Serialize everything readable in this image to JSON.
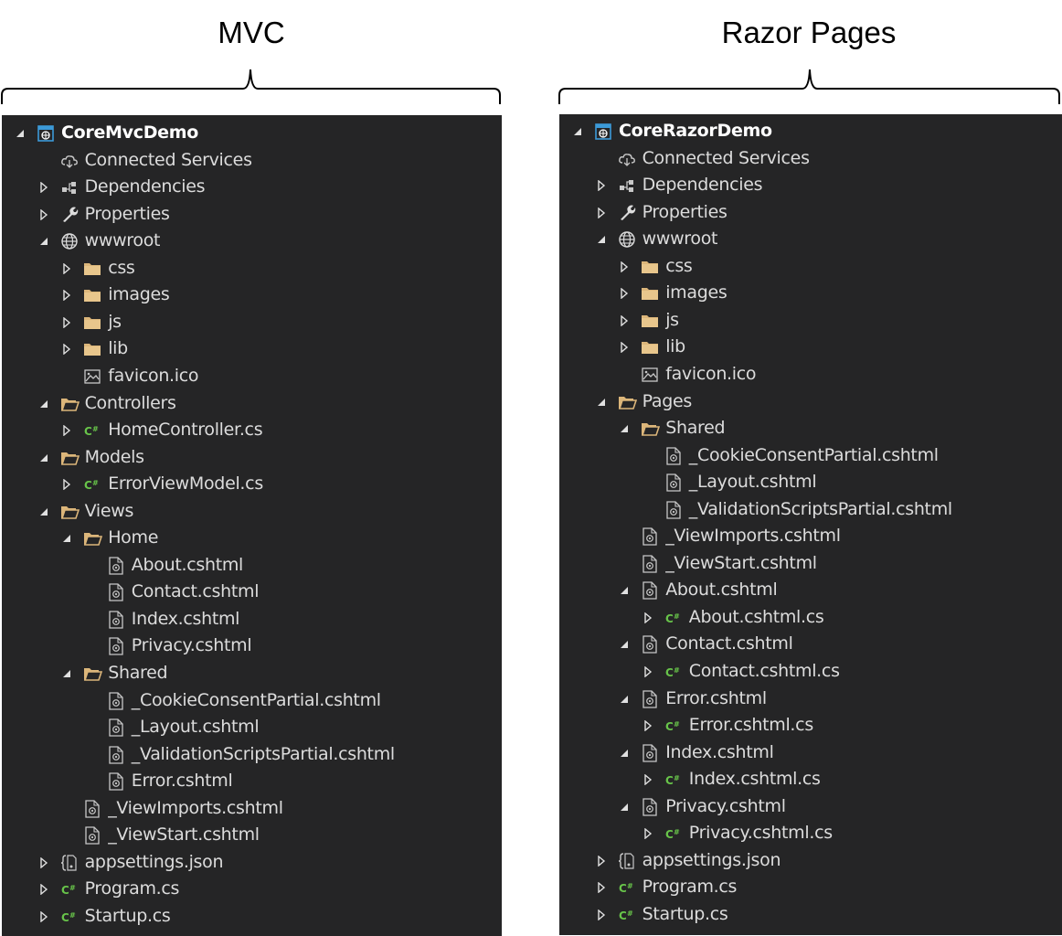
{
  "panels": [
    {
      "heading": "MVC",
      "project": "CoreMvcDemo",
      "items": [
        {
          "label": "CoreMvcDemo",
          "depth": 0,
          "arrow": "expanded",
          "icon": "project-icon",
          "bold": true
        },
        {
          "label": "Connected Services",
          "depth": 1,
          "arrow": "none",
          "icon": "cloud-icon"
        },
        {
          "label": "Dependencies",
          "depth": 1,
          "arrow": "collapsed",
          "icon": "dependencies-icon"
        },
        {
          "label": "Properties",
          "depth": 1,
          "arrow": "collapsed",
          "icon": "wrench-icon"
        },
        {
          "label": "wwwroot",
          "depth": 1,
          "arrow": "expanded",
          "icon": "globe-icon"
        },
        {
          "label": "css",
          "depth": 2,
          "arrow": "collapsed",
          "icon": "folder-icon"
        },
        {
          "label": "images",
          "depth": 2,
          "arrow": "collapsed",
          "icon": "folder-icon"
        },
        {
          "label": "js",
          "depth": 2,
          "arrow": "collapsed",
          "icon": "folder-icon"
        },
        {
          "label": "lib",
          "depth": 2,
          "arrow": "collapsed",
          "icon": "folder-icon"
        },
        {
          "label": "favicon.ico",
          "depth": 2,
          "arrow": "none",
          "icon": "image-file-icon"
        },
        {
          "label": "Controllers",
          "depth": 1,
          "arrow": "expanded",
          "icon": "folder-open-icon"
        },
        {
          "label": "HomeController.cs",
          "depth": 2,
          "arrow": "collapsed",
          "icon": "csharp-file-icon"
        },
        {
          "label": "Models",
          "depth": 1,
          "arrow": "expanded",
          "icon": "folder-open-icon"
        },
        {
          "label": "ErrorViewModel.cs",
          "depth": 2,
          "arrow": "collapsed",
          "icon": "csharp-file-icon"
        },
        {
          "label": "Views",
          "depth": 1,
          "arrow": "expanded",
          "icon": "folder-open-icon"
        },
        {
          "label": "Home",
          "depth": 2,
          "arrow": "expanded",
          "icon": "folder-open-icon"
        },
        {
          "label": "About.cshtml",
          "depth": 3,
          "arrow": "none",
          "icon": "razor-file-icon"
        },
        {
          "label": "Contact.cshtml",
          "depth": 3,
          "arrow": "none",
          "icon": "razor-file-icon"
        },
        {
          "label": "Index.cshtml",
          "depth": 3,
          "arrow": "none",
          "icon": "razor-file-icon"
        },
        {
          "label": "Privacy.cshtml",
          "depth": 3,
          "arrow": "none",
          "icon": "razor-file-icon"
        },
        {
          "label": "Shared",
          "depth": 2,
          "arrow": "expanded",
          "icon": "folder-open-icon"
        },
        {
          "label": "_CookieConsentPartial.cshtml",
          "depth": 3,
          "arrow": "none",
          "icon": "razor-file-icon"
        },
        {
          "label": "_Layout.cshtml",
          "depth": 3,
          "arrow": "none",
          "icon": "razor-file-icon"
        },
        {
          "label": "_ValidationScriptsPartial.cshtml",
          "depth": 3,
          "arrow": "none",
          "icon": "razor-file-icon"
        },
        {
          "label": "Error.cshtml",
          "depth": 3,
          "arrow": "none",
          "icon": "razor-file-icon"
        },
        {
          "label": "_ViewImports.cshtml",
          "depth": 2,
          "arrow": "none",
          "icon": "razor-file-icon"
        },
        {
          "label": "_ViewStart.cshtml",
          "depth": 2,
          "arrow": "none",
          "icon": "razor-file-icon"
        },
        {
          "label": "appsettings.json",
          "depth": 1,
          "arrow": "collapsed",
          "icon": "json-file-icon"
        },
        {
          "label": "Program.cs",
          "depth": 1,
          "arrow": "collapsed",
          "icon": "csharp-file-icon"
        },
        {
          "label": "Startup.cs",
          "depth": 1,
          "arrow": "collapsed",
          "icon": "csharp-file-icon"
        }
      ]
    },
    {
      "heading": "Razor Pages",
      "project": "CoreRazorDemo",
      "items": [
        {
          "label": "CoreRazorDemo",
          "depth": 0,
          "arrow": "expanded",
          "icon": "project-icon",
          "bold": true
        },
        {
          "label": "Connected Services",
          "depth": 1,
          "arrow": "none",
          "icon": "cloud-icon"
        },
        {
          "label": "Dependencies",
          "depth": 1,
          "arrow": "collapsed",
          "icon": "dependencies-icon"
        },
        {
          "label": "Properties",
          "depth": 1,
          "arrow": "collapsed",
          "icon": "wrench-icon"
        },
        {
          "label": "wwwroot",
          "depth": 1,
          "arrow": "expanded",
          "icon": "globe-icon"
        },
        {
          "label": "css",
          "depth": 2,
          "arrow": "collapsed",
          "icon": "folder-icon"
        },
        {
          "label": "images",
          "depth": 2,
          "arrow": "collapsed",
          "icon": "folder-icon"
        },
        {
          "label": "js",
          "depth": 2,
          "arrow": "collapsed",
          "icon": "folder-icon"
        },
        {
          "label": "lib",
          "depth": 2,
          "arrow": "collapsed",
          "icon": "folder-icon"
        },
        {
          "label": "favicon.ico",
          "depth": 2,
          "arrow": "none",
          "icon": "image-file-icon"
        },
        {
          "label": "Pages",
          "depth": 1,
          "arrow": "expanded",
          "icon": "folder-open-icon"
        },
        {
          "label": "Shared",
          "depth": 2,
          "arrow": "expanded",
          "icon": "folder-open-icon"
        },
        {
          "label": "_CookieConsentPartial.cshtml",
          "depth": 3,
          "arrow": "none",
          "icon": "razor-file-icon"
        },
        {
          "label": "_Layout.cshtml",
          "depth": 3,
          "arrow": "none",
          "icon": "razor-file-icon"
        },
        {
          "label": "_ValidationScriptsPartial.cshtml",
          "depth": 3,
          "arrow": "none",
          "icon": "razor-file-icon"
        },
        {
          "label": "_ViewImports.cshtml",
          "depth": 2,
          "arrow": "none",
          "icon": "razor-file-icon"
        },
        {
          "label": "_ViewStart.cshtml",
          "depth": 2,
          "arrow": "none",
          "icon": "razor-file-icon"
        },
        {
          "label": "About.cshtml",
          "depth": 2,
          "arrow": "expanded",
          "icon": "razor-file-icon"
        },
        {
          "label": "About.cshtml.cs",
          "depth": 3,
          "arrow": "collapsed",
          "icon": "csharp-file-icon"
        },
        {
          "label": "Contact.cshtml",
          "depth": 2,
          "arrow": "expanded",
          "icon": "razor-file-icon"
        },
        {
          "label": "Contact.cshtml.cs",
          "depth": 3,
          "arrow": "collapsed",
          "icon": "csharp-file-icon"
        },
        {
          "label": "Error.cshtml",
          "depth": 2,
          "arrow": "expanded",
          "icon": "razor-file-icon"
        },
        {
          "label": "Error.cshtml.cs",
          "depth": 3,
          "arrow": "collapsed",
          "icon": "csharp-file-icon"
        },
        {
          "label": "Index.cshtml",
          "depth": 2,
          "arrow": "expanded",
          "icon": "razor-file-icon"
        },
        {
          "label": "Index.cshtml.cs",
          "depth": 3,
          "arrow": "collapsed",
          "icon": "csharp-file-icon"
        },
        {
          "label": "Privacy.cshtml",
          "depth": 2,
          "arrow": "expanded",
          "icon": "razor-file-icon"
        },
        {
          "label": "Privacy.cshtml.cs",
          "depth": 3,
          "arrow": "collapsed",
          "icon": "csharp-file-icon"
        },
        {
          "label": "appsettings.json",
          "depth": 1,
          "arrow": "collapsed",
          "icon": "json-file-icon"
        },
        {
          "label": "Program.cs",
          "depth": 1,
          "arrow": "collapsed",
          "icon": "csharp-file-icon"
        },
        {
          "label": "Startup.cs",
          "depth": 1,
          "arrow": "collapsed",
          "icon": "csharp-file-icon"
        }
      ]
    }
  ],
  "colors": {
    "panel_bg": "#252526",
    "text": "#dcdcdc",
    "folder": "#dcb67a",
    "csharp": "#68c44a",
    "project": "#3c9ad8"
  }
}
